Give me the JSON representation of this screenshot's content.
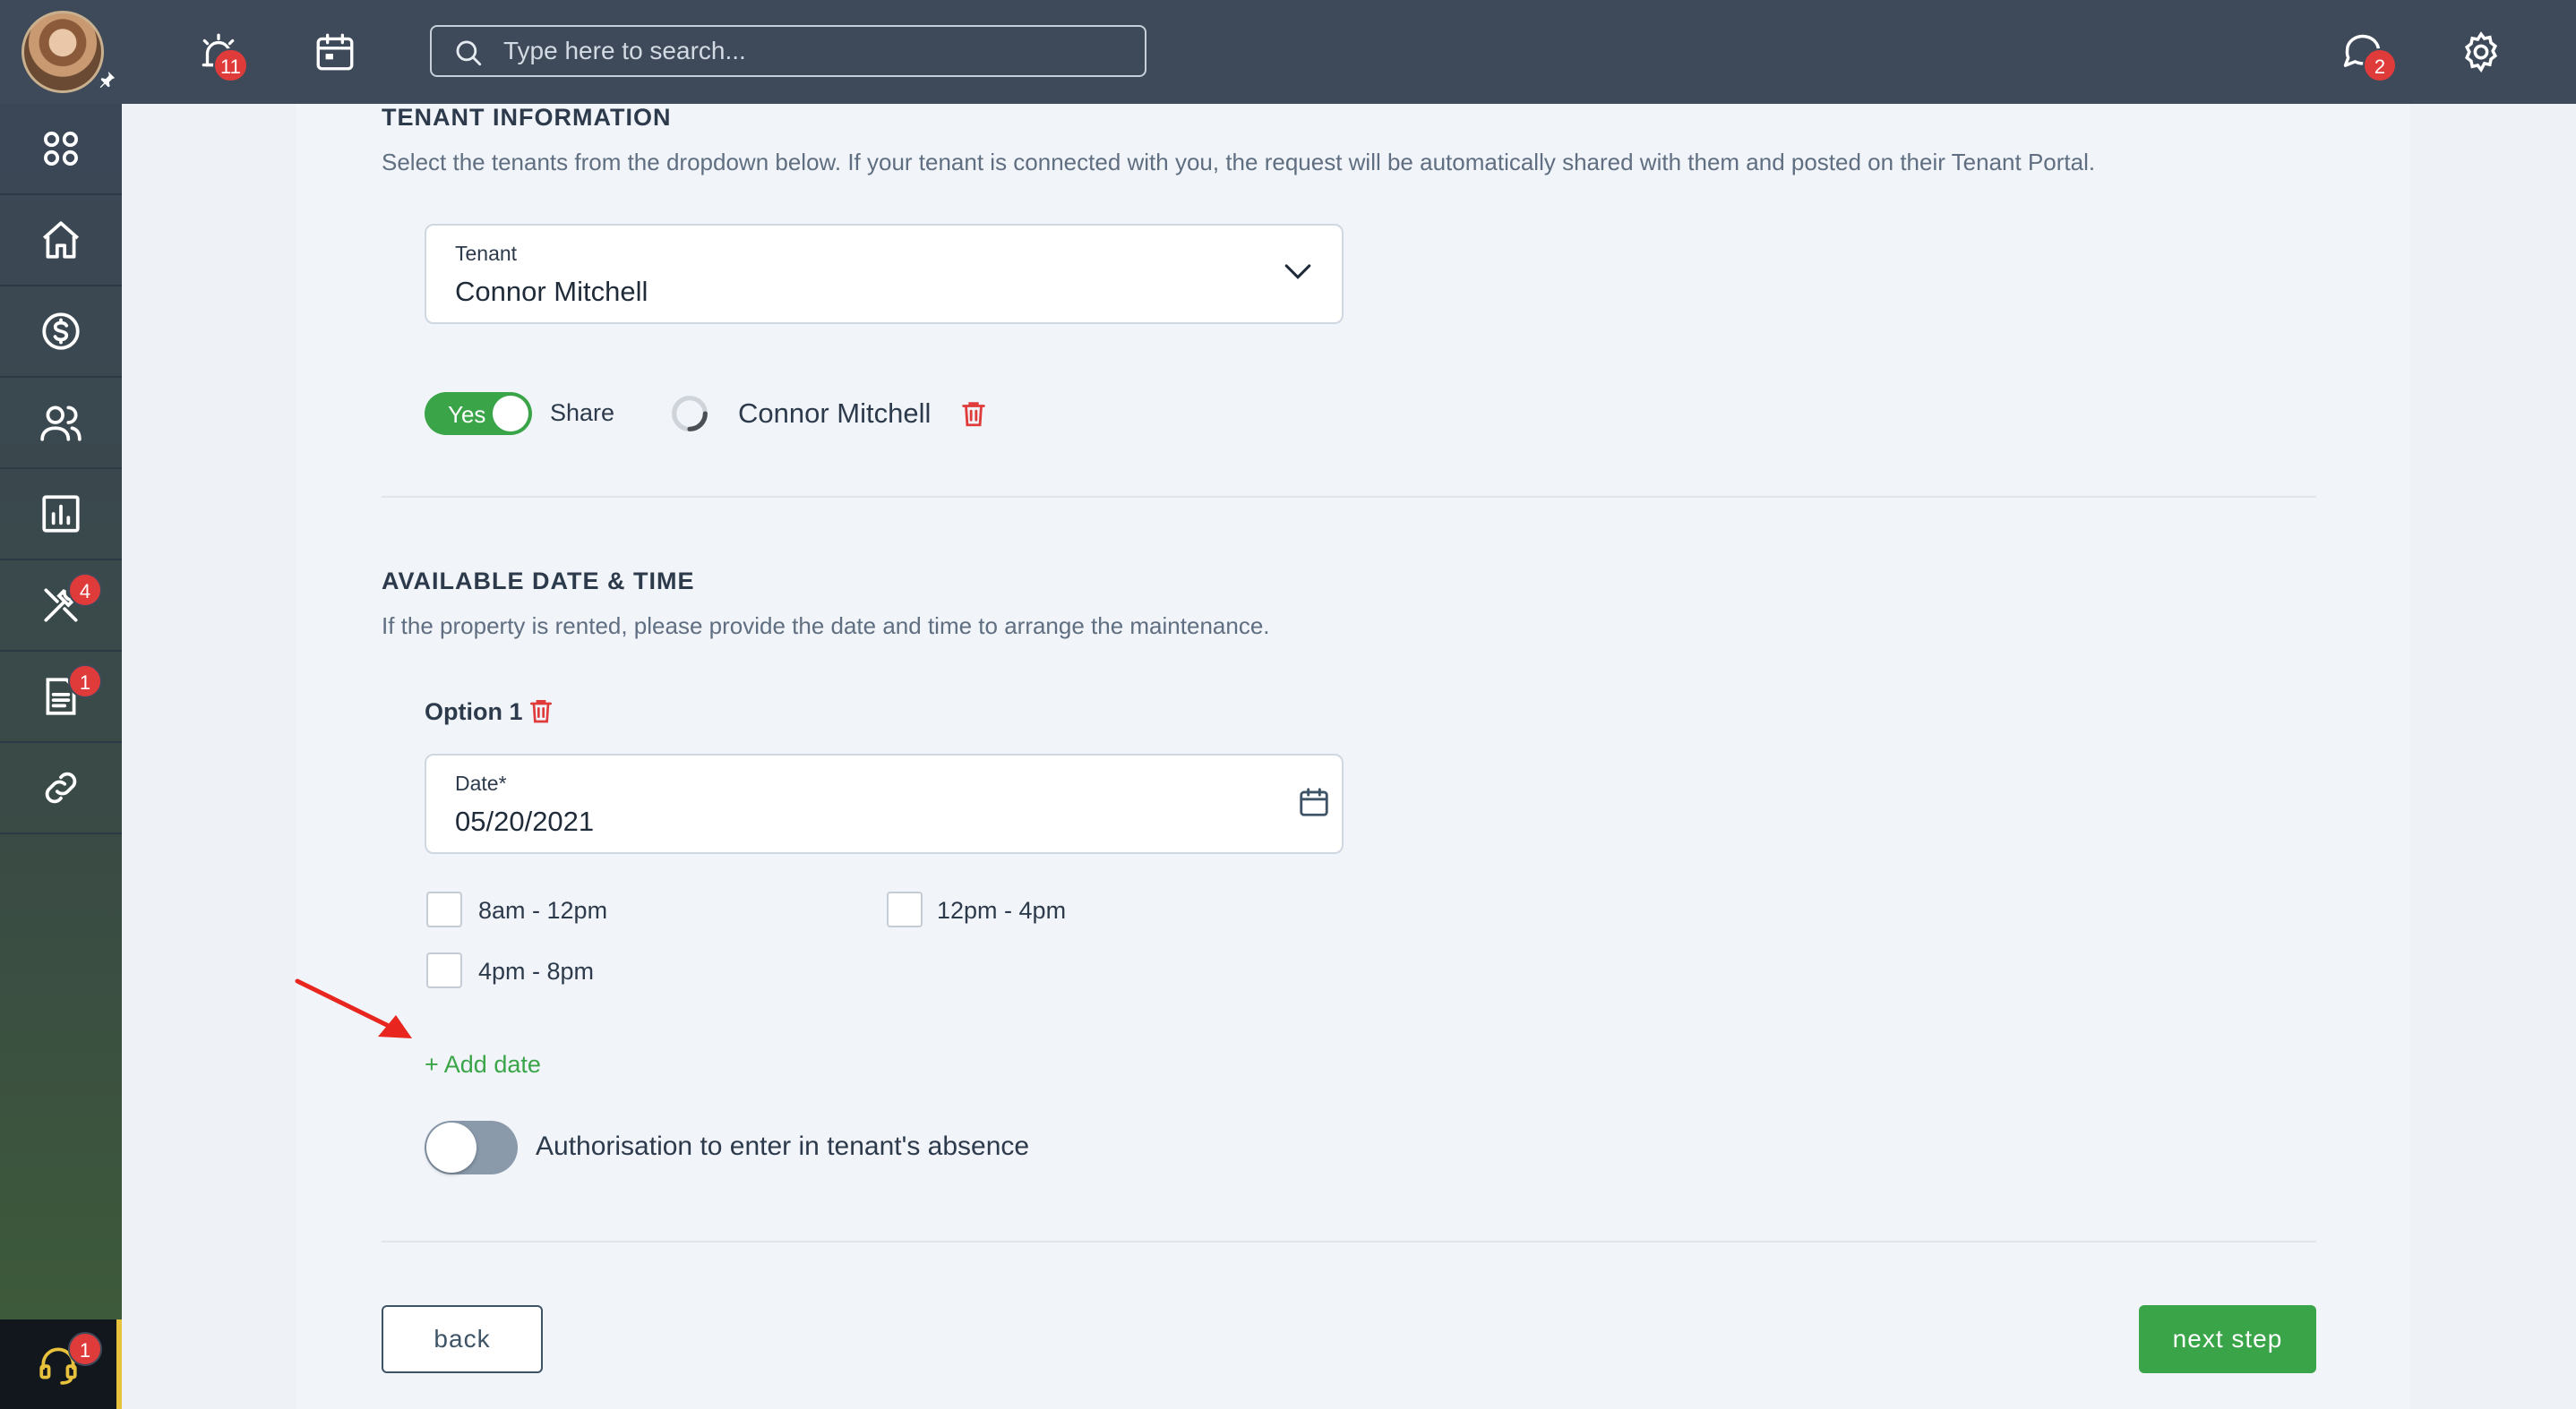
{
  "topbar": {
    "alerts_badge": "11",
    "messages_badge": "2",
    "search": {
      "placeholder": "Type here to search..."
    }
  },
  "sidebar": {
    "items": [
      {
        "icon": "apps-grid-icon"
      },
      {
        "icon": "home-icon"
      },
      {
        "icon": "dollar-icon"
      },
      {
        "icon": "users-icon"
      },
      {
        "icon": "bar-chart-icon"
      },
      {
        "icon": "tools-icon",
        "badge": "4"
      },
      {
        "icon": "document-icon",
        "badge": "1"
      },
      {
        "icon": "link-icon"
      }
    ],
    "support_badge": "1"
  },
  "tenant_section": {
    "title": "TENANT INFORMATION",
    "description": "Select the tenants from the dropdown below. If your tenant is connected with you, the request will be automatically shared with them and posted on their Tenant Portal.",
    "tenant_field": {
      "label": "Tenant",
      "value": "Connor Mitchell"
    },
    "share_toggle": {
      "state_label": "Yes",
      "label": "Share",
      "on": true
    },
    "tenant_name": "Connor Mitchell"
  },
  "date_section": {
    "title": "AVAILABLE DATE & TIME",
    "description": "If the property is rented, please provide the date and time to arrange the maintenance.",
    "option_label": "Option 1",
    "date_field": {
      "label": "Date*",
      "value": "05/20/2021"
    },
    "slots": [
      {
        "label": "8am - 12pm",
        "checked": false
      },
      {
        "label": "12pm - 4pm",
        "checked": false
      },
      {
        "label": "4pm - 8pm",
        "checked": false
      }
    ],
    "add_date_label": "+ Add date",
    "authorisation": {
      "label": "Authorisation to enter in tenant's absence",
      "on": false
    }
  },
  "footer": {
    "back_label": "back",
    "next_label": "next step"
  },
  "colors": {
    "accent_green": "#3aa548",
    "topbar": "#3e4a59",
    "badge_red": "#e03b3b",
    "annotation_arrow": "#e8261f"
  }
}
